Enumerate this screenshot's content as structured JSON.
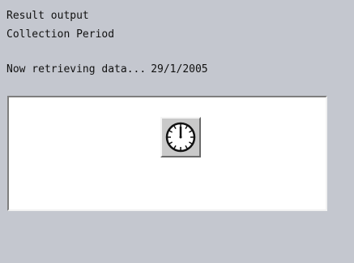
{
  "header": {
    "line1": "Result output",
    "line2": "Collection Period"
  },
  "status": {
    "message": "Now retrieving data...",
    "date": "29/1/2005"
  },
  "panel": {
    "icon": "clock-icon"
  },
  "colors": {
    "background": "#c4c7cf",
    "panel": "#ffffff",
    "button_face": "#c9c9c9"
  }
}
